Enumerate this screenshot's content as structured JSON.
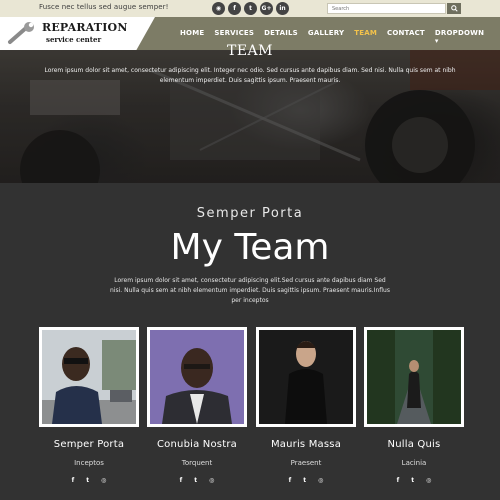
{
  "topbar": {
    "tagline": "Fusce nec tellus sed augue semper!",
    "search_placeholder": "Search",
    "socials": [
      {
        "icon": "rss-icon",
        "glyph": "◉"
      },
      {
        "icon": "facebook-icon",
        "glyph": "f"
      },
      {
        "icon": "twitter-icon",
        "glyph": "t"
      },
      {
        "icon": "google-plus-icon",
        "glyph": "G+"
      },
      {
        "icon": "linkedin-icon",
        "glyph": "in"
      }
    ]
  },
  "logo": {
    "title": "REPARATION",
    "subtitle": "service center"
  },
  "nav": {
    "items": [
      "HOME",
      "SERVICES",
      "DETAILS",
      "GALLERY",
      "TEAM",
      "CONTACT",
      "DROPDOWN ▾"
    ],
    "active_index": 4,
    "active_color": "#f3c24b"
  },
  "hero": {
    "title": "TEAM",
    "text": "Lorem ipsum dolor sit amet, consectetur adipiscing elit. Integer nec odio. Sed cursus ante dapibus diam. Sed nisi. Nulla quis sem at nibh elementum imperdiet. Duis sagittis ipsum. Praesent mauris."
  },
  "team": {
    "kicker": "Semper Porta",
    "heading": "My Team",
    "intro": "Lorem ipsum dolor sit amet, consectetur adipiscing elit.Sed cursus ante dapibus diam Sed nisi. Nulla quis sem at nibh elementum imperdiet. Duis sagittis ipsum. Praesent mauris.Influs per inceptos",
    "members": [
      {
        "name": "Semper Porta",
        "role": "Inceptos"
      },
      {
        "name": "Conubia Nostra",
        "role": "Torquent"
      },
      {
        "name": "Mauris Massa",
        "role": "Praesent"
      },
      {
        "name": "Nulla Quis",
        "role": "Lacinia"
      }
    ],
    "member_socials": [
      "f",
      "t",
      "◎"
    ]
  }
}
